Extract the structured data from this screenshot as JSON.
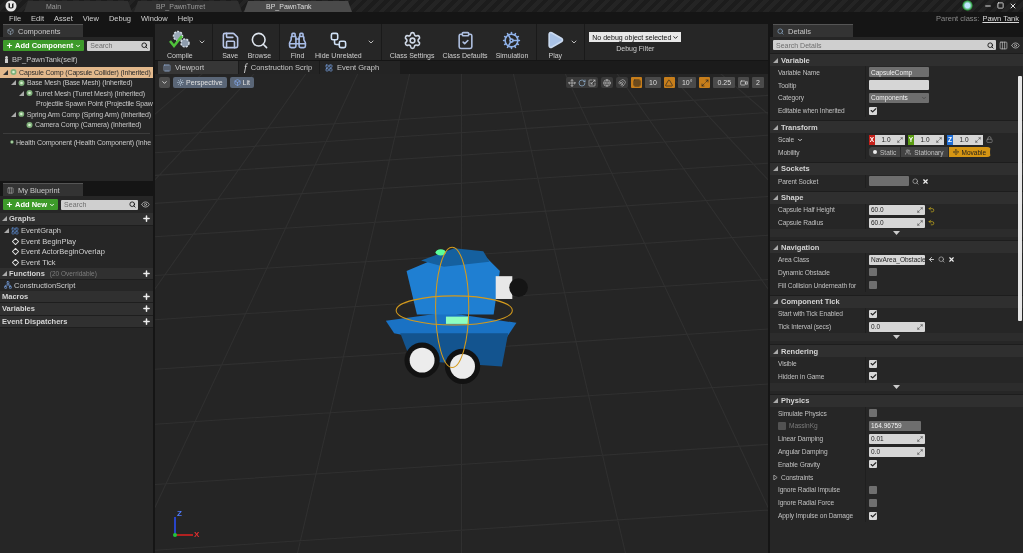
{
  "doc_tabs": [
    {
      "label": "Main",
      "selected": false
    },
    {
      "label": "BP_PawnTurret",
      "selected": false
    },
    {
      "label": "BP_PawnTank",
      "selected": true
    }
  ],
  "menu": [
    "File",
    "Edit",
    "Asset",
    "View",
    "Debug",
    "Window",
    "Help"
  ],
  "parent_class": {
    "label": "Parent class:",
    "value": "Pawn Tank"
  },
  "components": {
    "title": "Components",
    "add_button": "Add Component",
    "search_placeholder": "Search",
    "self": "BP_PawnTank(self)",
    "tree": [
      {
        "label": "Capsule Comp (Capsule Collider) (Inherited)",
        "selected": true,
        "expanded": true,
        "children": [
          {
            "label": "Base Mesh (Base Mesh) (Inherited)",
            "selected": false,
            "expanded": true,
            "children": [
              {
                "label": "Turret Mesh (Turret Mesh) (Inherited)",
                "selected": false,
                "expanded": true,
                "children": [
                  {
                    "label": "Projectile Spawn Point (Projectile Spaw",
                    "selected": false
                  }
                ]
              }
            ]
          },
          {
            "label": "Spring Arm Comp (Spring Arm) (Inherited)",
            "selected": false,
            "expanded": true,
            "children": [
              {
                "label": "Camera Comp (Camera) (Inherited)",
                "selected": false
              }
            ]
          }
        ]
      },
      {
        "label": "Health Component (Health Component) (Inhe",
        "selected": false
      }
    ]
  },
  "my_blueprint": {
    "title": "My Blueprint",
    "add_button": "Add New",
    "search_placeholder": "Search",
    "sections": [
      {
        "title": "Graphs",
        "expanded": true,
        "items": [
          {
            "label": "EventGraph",
            "expanded": true,
            "children": [
              {
                "label": "Event BeginPlay"
              },
              {
                "label": "Event ActorBeginOverlap"
              },
              {
                "label": "Event Tick"
              }
            ]
          }
        ]
      },
      {
        "title": "Functions",
        "note": "(20 Overridable)",
        "expanded": true,
        "items": [
          {
            "label": "ConstructionScript"
          }
        ]
      },
      {
        "title": "Macros"
      },
      {
        "title": "Variables"
      },
      {
        "title": "Event Dispatchers"
      }
    ]
  },
  "toolbar": {
    "groups": [
      [
        {
          "kind": "compile",
          "label": "Compile",
          "menu": true
        }
      ],
      [
        {
          "kind": "save",
          "label": "Save"
        },
        {
          "kind": "browse",
          "label": "Browse"
        }
      ],
      [
        {
          "kind": "find",
          "label": "Find"
        },
        {
          "kind": "hide",
          "label": "Hide Unrelated",
          "menu": true
        }
      ],
      [
        {
          "kind": "settings",
          "label": "Class Settings"
        },
        {
          "kind": "defaults",
          "label": "Class Defaults"
        },
        {
          "kind": "simulation",
          "label": "Simulation"
        }
      ],
      [
        {
          "kind": "play",
          "label": "Play",
          "menu": true
        }
      ]
    ],
    "debug_filter": {
      "value": "No debug object selected",
      "label": "Debug Filter"
    }
  },
  "editor_tabs": [
    {
      "label": "Viewport",
      "kind": "viewport",
      "selected": true
    },
    {
      "label": "Construction Scrip",
      "glyph": "f",
      "selected": false
    },
    {
      "label": "Event Graph",
      "kind": "graph",
      "selected": false
    }
  ],
  "viewport": {
    "view": "Perspective",
    "mode": "Lit",
    "snaps": [
      {
        "kind": "grid",
        "value": "10",
        "on": true
      },
      {
        "kind": "rotate",
        "value": "10°",
        "on": true
      },
      {
        "kind": "scale",
        "value": "0.25",
        "on": true
      },
      {
        "kind": "camera",
        "value": "2",
        "on": false
      }
    ],
    "axes": [
      "Z",
      "X"
    ]
  },
  "details": {
    "title": "Details",
    "search_placeholder": "Search Details",
    "sections": [
      {
        "title": "Variable",
        "expanded": true,
        "rows": [
          {
            "kind": "text",
            "label": "Variable Name",
            "value": "CapsuleComp"
          },
          {
            "kind": "text",
            "label": "Tooltip"
          },
          {
            "kind": "dropdown",
            "label": "Category",
            "value": "Components"
          },
          {
            "kind": "checkbox",
            "label": "Editable when Inherited",
            "checked": true
          }
        ]
      },
      {
        "title": "Transform",
        "expanded": true,
        "rows": [
          {
            "kind": "vector",
            "label": "Scale",
            "menu": true,
            "axes": [
              {
                "axis": "X",
                "value": "1.0",
                "color": "#c6201a"
              },
              {
                "axis": "Y",
                "value": "1.0",
                "color": "#5b9c13"
              },
              {
                "axis": "Z",
                "value": "1.0",
                "color": "#1f6fd8"
              }
            ]
          },
          {
            "kind": "segmented",
            "label": "Mobility",
            "options": [
              {
                "label": "Static",
                "selected": false
              },
              {
                "label": "Stationary",
                "selected": false
              },
              {
                "label": "Movable",
                "selected": true
              }
            ]
          }
        ]
      },
      {
        "title": "Sockets",
        "expanded": true,
        "rows": [
          {
            "kind": "socket",
            "label": "Parent Socket"
          }
        ]
      },
      {
        "title": "Shape",
        "expanded": true,
        "advanced": true,
        "rows": [
          {
            "kind": "number",
            "label": "Capsule Half Height",
            "value": "60.0",
            "reset": true
          },
          {
            "kind": "number",
            "label": "Capsule Radius",
            "value": "60.0",
            "reset": true
          }
        ]
      },
      {
        "title": "Navigation",
        "expanded": true,
        "rows": [
          {
            "kind": "class",
            "label": "Area Class",
            "value": "NavArea_Obstacle"
          },
          {
            "kind": "checkbox",
            "label": "Dynamic Obstacle",
            "checked": false
          },
          {
            "kind": "checkbox",
            "label": "Fill Collision Underneath for",
            "checked": false
          }
        ]
      },
      {
        "title": "Component Tick",
        "expanded": true,
        "advanced": true,
        "rows": [
          {
            "kind": "checkbox",
            "label": "Start with Tick Enabled",
            "checked": true
          },
          {
            "kind": "number",
            "label": "Tick Interval (secs)",
            "value": "0.0"
          }
        ]
      },
      {
        "title": "Rendering",
        "expanded": true,
        "advanced": true,
        "rows": [
          {
            "kind": "checkbox",
            "label": "Visible",
            "checked": true
          },
          {
            "kind": "checkbox",
            "label": "Hidden in Game",
            "checked": true
          }
        ]
      },
      {
        "title": "Physics",
        "expanded": true,
        "rows": [
          {
            "kind": "checkbox",
            "label": "Simulate Physics",
            "checked": false
          },
          {
            "kind": "mass",
            "label": "MassInKg",
            "checked": false,
            "value": "164.96759"
          },
          {
            "kind": "number",
            "label": "Linear Damping",
            "value": "0.01"
          },
          {
            "kind": "number",
            "label": "Angular Damping",
            "value": "0.0"
          },
          {
            "kind": "checkbox",
            "label": "Enable Gravity",
            "checked": true
          },
          {
            "kind": "group",
            "label": "Constraints",
            "expanded": false
          },
          {
            "kind": "checkbox",
            "label": "Ignore Radial Impulse",
            "checked": false
          },
          {
            "kind": "checkbox",
            "label": "Ignore Radial Force",
            "checked": false
          },
          {
            "kind": "checkbox",
            "label": "Apply Impulse on Damage",
            "checked": true
          }
        ]
      }
    ]
  }
}
